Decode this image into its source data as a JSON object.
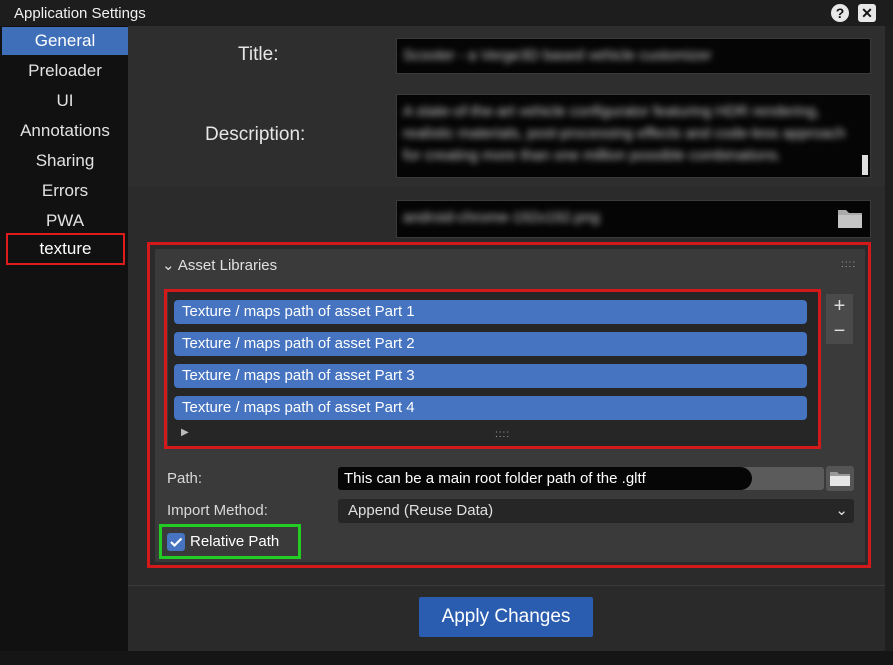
{
  "window": {
    "title": "Application Settings",
    "help_label": "?",
    "close_label": "✕"
  },
  "sidebar": {
    "items": [
      {
        "label": "General"
      },
      {
        "label": "Preloader"
      },
      {
        "label": "UI"
      },
      {
        "label": "Annotations"
      },
      {
        "label": "Sharing"
      },
      {
        "label": "Errors"
      },
      {
        "label": "PWA"
      },
      {
        "label": "texture"
      }
    ]
  },
  "form": {
    "title_label": "Title:",
    "title_value": "Scooter - a Verge3D based vehicle customizer",
    "description_label": "Description:",
    "description_value": "A state-of-the-art vehicle configurator featuring HDR rendering, realistic materials, post-processing effects and code-less approach for creating more than one million possible combinations.",
    "icon_file_value": "android-chrome-192x192.png"
  },
  "asset_libraries": {
    "header": "Asset Libraries",
    "items": [
      {
        "label": "Texture / maps path of asset  Part 1"
      },
      {
        "label": "Texture / maps path of asset  Part  2"
      },
      {
        "label": "Texture / maps path of asset  Part  3"
      },
      {
        "label": "Texture / maps path of asset  Part  4"
      }
    ],
    "add_label": "+",
    "remove_label": "−",
    "path_label": "Path:",
    "path_value": "This can be a main root folder path of the .gltf",
    "import_method_label": "Import Method:",
    "import_method_value": "Append (Reuse Data)",
    "relative_path_label": "Relative Path",
    "relative_path_checked": true
  },
  "footer": {
    "apply_label": "Apply Changes"
  },
  "colors": {
    "accent": "#4674c0",
    "highlight_red": "#d31919",
    "highlight_green": "#22cc22"
  }
}
